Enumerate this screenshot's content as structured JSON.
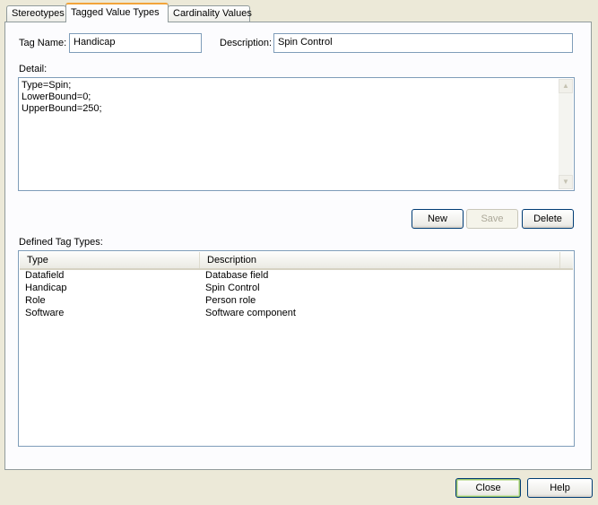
{
  "tabs": [
    "Stereotypes",
    "Tagged Value Types",
    "Cardinality Values"
  ],
  "form": {
    "tag_name_label": "Tag Name:",
    "tag_name_value": "Handicap",
    "description_label": "Description:",
    "description_value": "Spin Control",
    "detail_label": "Detail:",
    "detail_value": "Type=Spin;\nLowerBound=0;\nUpperBound=250;"
  },
  "actions": {
    "new": "New",
    "save": "Save",
    "delete": "Delete"
  },
  "list": {
    "label": "Defined Tag Types:",
    "columns": [
      "Type",
      "Description"
    ],
    "rows": [
      [
        "Datafield",
        "Database field"
      ],
      [
        "Handicap",
        "Spin Control"
      ],
      [
        "Role",
        "Person role"
      ],
      [
        "Software",
        "Software component"
      ]
    ]
  },
  "footer": {
    "close": "Close",
    "help": "Help"
  },
  "icons": {
    "scroll_up": "chevron-up-icon",
    "scroll_down": "chevron-down-icon"
  }
}
